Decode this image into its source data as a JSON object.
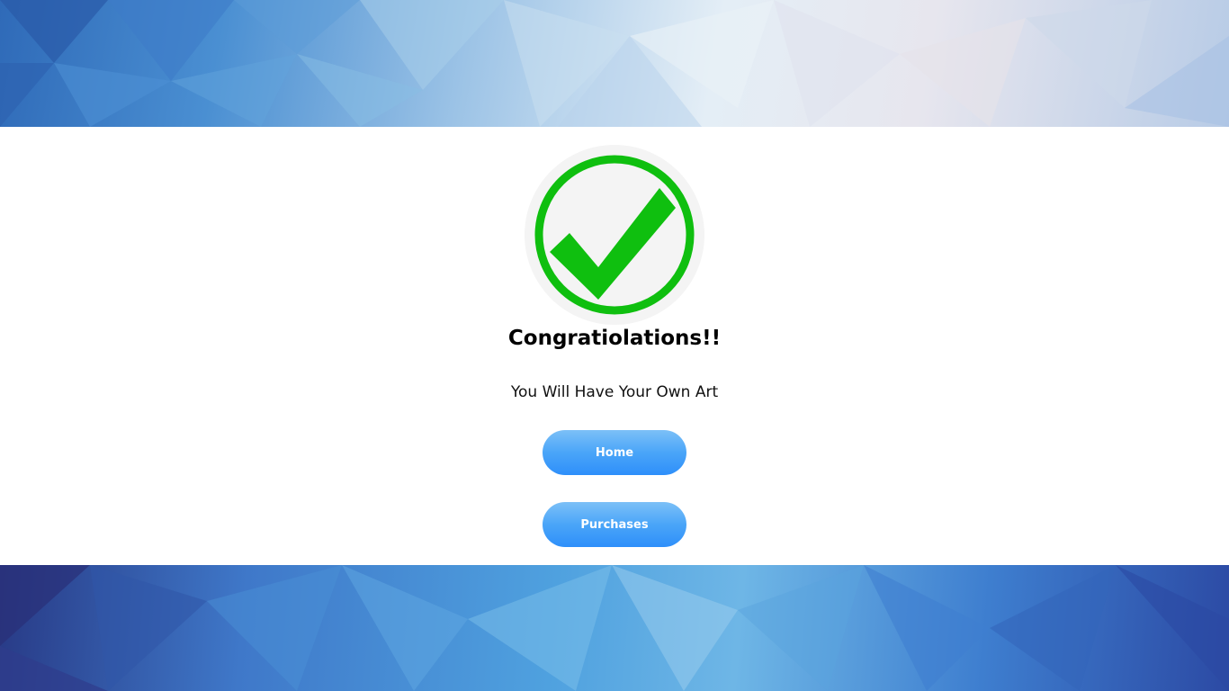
{
  "success": {
    "icon": "checkmark-circle-icon",
    "title": "Congratiolations!!",
    "message": "You Will Have Your Own Art"
  },
  "actions": {
    "home_label": "Home",
    "purchases_label": "Purchases"
  },
  "colors": {
    "check_green": "#0fbf0f",
    "button_top": "#7cc0f7",
    "button_bottom": "#2e8ffa",
    "card_bg": "#ffffff"
  }
}
